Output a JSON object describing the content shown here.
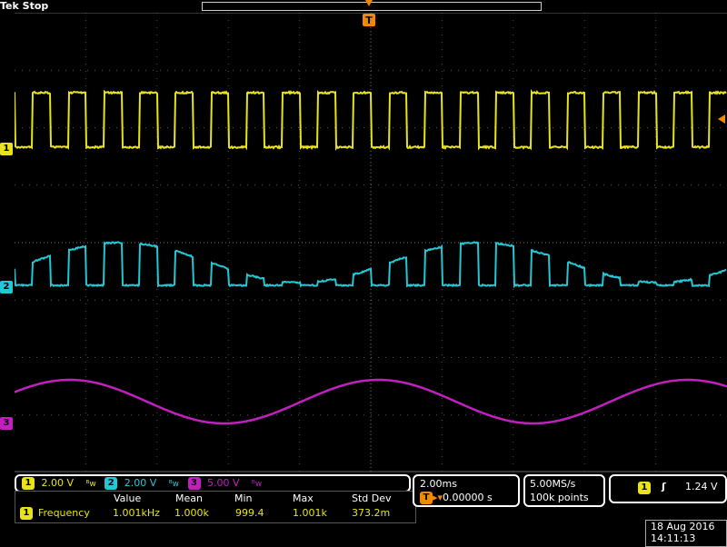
{
  "status": {
    "brand": "Tek",
    "state": "Stop"
  },
  "trigger_marker": "T",
  "channels": [
    {
      "id": "1",
      "color": "#e8e31a",
      "scale": "2.00 V"
    },
    {
      "id": "2",
      "color": "#22c8d6",
      "scale": "2.00 V"
    },
    {
      "id": "3",
      "color": "#c21fbf",
      "scale": "5.00 V"
    }
  ],
  "bandwidth_glyph": "ᴮw",
  "timebase": {
    "scale": "2.00ms",
    "delay": "0.00000 s"
  },
  "acquisition": {
    "rate": "5.00MS/s",
    "points": "100k points"
  },
  "trigger": {
    "source": "1",
    "slope_glyph": "ʃ",
    "level": "1.24 V"
  },
  "measurement": {
    "headers": [
      "Value",
      "Mean",
      "Min",
      "Max",
      "Std Dev"
    ],
    "channel": "1",
    "name": "Frequency",
    "values": [
      "1.001kHz",
      "1.000k",
      "999.4",
      "1.001k",
      "373.2m"
    ]
  },
  "datetime": {
    "date": "18 Aug 2016",
    "time": "14:11:13"
  }
}
